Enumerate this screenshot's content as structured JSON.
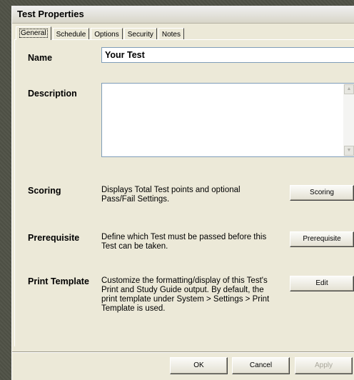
{
  "window": {
    "title": "Test Properties"
  },
  "tabs": [
    "General",
    "Schedule",
    "Options",
    "Security",
    "Notes"
  ],
  "fields": {
    "name": {
      "label": "Name",
      "value": "Your Test"
    },
    "description": {
      "label": "Description",
      "value": ""
    }
  },
  "sections": {
    "scoring": {
      "label": "Scoring",
      "description": "Displays Total Test points and optional Pass/Fail Settings.",
      "button": "Scoring"
    },
    "prerequisite": {
      "label": "Prerequisite",
      "description": "Define which Test must be passed before this Test can be taken.",
      "button": "Prerequisite"
    },
    "print_template": {
      "label": "Print Template",
      "description": "Customize the formatting/display of this Test's Print and Study Guide output.  By default, the print template under System > Settings > Print Template is used.",
      "button": "Edit"
    }
  },
  "footer": {
    "ok": "OK",
    "cancel": "Cancel",
    "apply": "Apply"
  },
  "icons": {
    "scroll_up": "scroll-up-arrow-icon",
    "scroll_down": "scroll-down-arrow-icon"
  },
  "colors": {
    "window_bg": "#ece9d8",
    "input_border": "#7f9db9",
    "desktop_bg": "#505246"
  }
}
